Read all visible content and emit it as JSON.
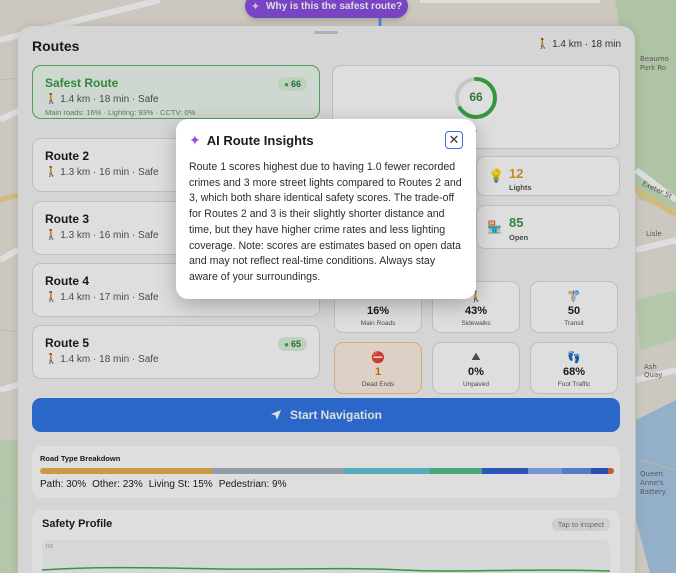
{
  "top_pill": {
    "label": "Why is this the safest route?"
  },
  "header": {
    "title": "Routes",
    "summary": "🚶 1.4 km · 18 min"
  },
  "routes": [
    {
      "name": "Safest Route",
      "meta": "🚶 1.4 km · 18 min · Safe",
      "extra": "Main roads: 16% · Lighting: 93% · CCTV: 0%",
      "score": "66"
    },
    {
      "name": "Route 2",
      "meta": "🚶 1.3 km · 16 min · Safe",
      "extra": "",
      "score": ""
    },
    {
      "name": "Route 3",
      "meta": "🚶 1.3 km · 16 min · Safe",
      "extra": "",
      "score": ""
    },
    {
      "name": "Route 4",
      "meta": "🚶 1.4 km · 17 min · Safe",
      "extra": "",
      "score": ""
    },
    {
      "name": "Route 5",
      "meta": "🚶 1.4 km · 18 min · Safe",
      "extra": "",
      "score": "65"
    }
  ],
  "score_panel": {
    "value": "66",
    "fraction": 0.66,
    "label": "fe"
  },
  "metrics": {
    "lights": {
      "value": "12",
      "label": "Lights",
      "icon": "bulb-icon"
    },
    "open": {
      "value": "85",
      "label": "Open",
      "icon": "shop-icon"
    }
  },
  "stats": [
    {
      "value": "16%",
      "label": "Main Roads",
      "icon": "road-icon",
      "warn": false
    },
    {
      "value": "43%",
      "label": "Sidewalks",
      "icon": "walker-icon",
      "warn": false
    },
    {
      "value": "50",
      "label": "Transit",
      "icon": "bus-stop-icon",
      "warn": false
    },
    {
      "value": "1",
      "label": "Dead Ends",
      "icon": "no-entry-icon",
      "warn": true
    },
    {
      "value": "0%",
      "label": "Unpaved",
      "icon": "unpaved-icon",
      "warn": false
    },
    {
      "value": "68%",
      "label": "Foot Traffic",
      "icon": "footprints-icon",
      "warn": false
    }
  ],
  "start_button": {
    "label": "Start Navigation"
  },
  "breakdown": {
    "title": "Road Type Breakdown",
    "legend": [
      "Path: 30%",
      "Other: 23%",
      "Living St: 15%",
      "Pedestrian: 9%"
    ],
    "segments": [
      {
        "pct": 30,
        "color": "#e8b04c"
      },
      {
        "pct": 23,
        "color": "#a9b3bf"
      },
      {
        "pct": 15,
        "color": "#66c3d6"
      },
      {
        "pct": 9,
        "color": "#4fbf8d"
      },
      {
        "pct": 8,
        "color": "#3463d1"
      },
      {
        "pct": 6,
        "color": "#86aef0"
      },
      {
        "pct": 5,
        "color": "#5f8fe8"
      },
      {
        "pct": 3,
        "color": "#2f5bc7"
      },
      {
        "pct": 1,
        "color": "#e06a3a"
      }
    ]
  },
  "safety_profile": {
    "title": "Safety Profile",
    "badge": "Tap to inspect",
    "tick": "100"
  },
  "modal": {
    "title": "AI Route Insights",
    "body": "Route 1 scores highest due to having 1.0 fewer recorded crimes and 3 more street lights compared to Routes 2 and 3, which both share identical safety scores. The trade-off for Routes 2 and 3 is their slightly shorter distance and time, but they have higher crime rates and less lighting coverage. Note: scores are estimates based on open data and may not reflect real-time conditions. Always stay aware of your surroundings."
  },
  "map_labels": [
    "Beaumo",
    "Park Ro",
    "Exeter St",
    "Lisle",
    "Ash Quay",
    "Queen",
    "Anne's",
    "Battery"
  ],
  "colors": {
    "accent": "#3277e6",
    "safe_green": "#3fae4b",
    "purple": "#8b4fe0",
    "warning": "#d87a14"
  }
}
